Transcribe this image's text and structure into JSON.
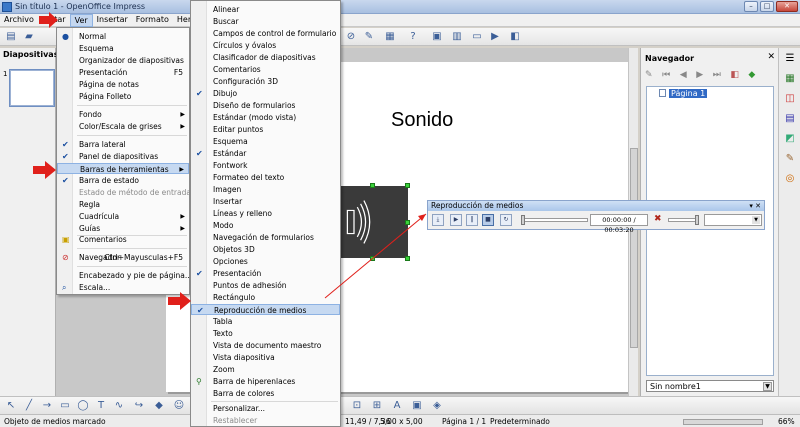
{
  "window": {
    "title": "Sin título 1 - OpenOffice Impress"
  },
  "menubar": {
    "items": [
      "Archivo",
      "Editar",
      "Ver",
      "Insertar",
      "Formato",
      "Herramientas"
    ]
  },
  "left_panel": {
    "title": "Diapositivas",
    "slide_number": "1"
  },
  "slide": {
    "title": "Sonido"
  },
  "navigator": {
    "title": "Navegador",
    "item": "Página 1",
    "select_value": "Sin nombre1"
  },
  "ver_menu": {
    "items": [
      {
        "label": "Normal",
        "mark": "radio"
      },
      {
        "label": "Esquema"
      },
      {
        "label": "Organizador de diapositivas"
      },
      {
        "label": "Presentación",
        "shortcut": "F5"
      },
      {
        "label": "Página de notas"
      },
      {
        "label": "Página Folleto"
      },
      {
        "label": "Fondo",
        "submenu": true
      },
      {
        "label": "Color/Escala de grises",
        "submenu": true
      },
      {
        "label": "Barra lateral",
        "check": true
      },
      {
        "label": "Panel de diapositivas",
        "check": true
      },
      {
        "label": "Barras de herramientas",
        "submenu": true,
        "highlight": true
      },
      {
        "label": "Barra de estado",
        "check": true
      },
      {
        "label": "Estado de método de entrada",
        "disabled": true
      },
      {
        "label": "Regla"
      },
      {
        "label": "Cuadrícula",
        "submenu": true
      },
      {
        "label": "Guías",
        "submenu": true
      },
      {
        "label": "Comentarios"
      },
      {
        "label": "Navegador",
        "shortcut": "Ctrl+Mayusculas+F5"
      },
      {
        "label": "Encabezado y pie de página..."
      },
      {
        "label": "Escala..."
      }
    ]
  },
  "toolbars_menu": {
    "items": [
      {
        "label": "Alinear"
      },
      {
        "label": "Buscar"
      },
      {
        "label": "Campos de control de formulario"
      },
      {
        "label": "Círculos y óvalos"
      },
      {
        "label": "Clasificador de diapositivas"
      },
      {
        "label": "Comentarios"
      },
      {
        "label": "Configuración 3D"
      },
      {
        "label": "Dibujo",
        "check": true
      },
      {
        "label": "Diseño de formularios"
      },
      {
        "label": "Estándar (modo vista)"
      },
      {
        "label": "Editar puntos"
      },
      {
        "label": "Esquema"
      },
      {
        "label": "Estándar",
        "check": true
      },
      {
        "label": "Fontwork"
      },
      {
        "label": "Formateo del texto"
      },
      {
        "label": "Imagen"
      },
      {
        "label": "Insertar"
      },
      {
        "label": "Líneas y relleno"
      },
      {
        "label": "Modo"
      },
      {
        "label": "Navegación de formularios"
      },
      {
        "label": "Objetos 3D"
      },
      {
        "label": "Opciones"
      },
      {
        "label": "Presentación",
        "check": true
      },
      {
        "label": "Puntos de adhesión"
      },
      {
        "label": "Rectángulo"
      },
      {
        "label": "Reproducción de medios",
        "check": true,
        "highlight": true
      },
      {
        "label": "Tabla"
      },
      {
        "label": "Texto"
      },
      {
        "label": "Vista de documento maestro"
      },
      {
        "label": "Vista diapositiva"
      },
      {
        "label": "Zoom"
      },
      {
        "label": "Barra de hiperenlaces"
      },
      {
        "label": "Barra de colores"
      },
      {
        "label": "Personalizar..."
      },
      {
        "label": "Restablecer",
        "disabled": true
      }
    ]
  },
  "media_toolbar": {
    "title": "Reproducción de medios",
    "time": "00:00:00 / 00:03:20"
  },
  "statusbar": {
    "status_text": "Objeto de medios marcado",
    "position": "11,49 / 7,36",
    "size": "5,00 x 5,00",
    "page": "Página 1 / 1",
    "layout": "Predeterminado",
    "zoom": "66%"
  },
  "colors": {
    "selection": "#c6d9f1",
    "accent": "#316ac5",
    "annotation": "#e0201b"
  }
}
